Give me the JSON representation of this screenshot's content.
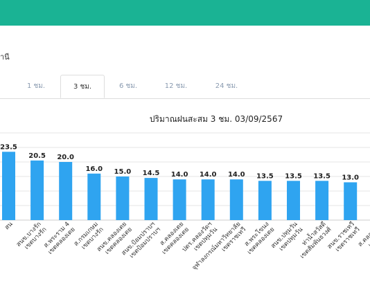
{
  "header": {
    "bar_color": "#1ab394"
  },
  "station_text": "านี",
  "tabs": [
    {
      "label": "ี",
      "active": false
    },
    {
      "label": "1 ชม.",
      "active": false
    },
    {
      "label": "3 ชม.",
      "active": true
    },
    {
      "label": "6 ชม.",
      "active": false
    },
    {
      "label": "12 ชม.",
      "active": false
    },
    {
      "label": "24 ชม.",
      "active": false
    }
  ],
  "chart_data": {
    "type": "bar",
    "title": "ปริมาณฝนสะสม 3 ชม. 03/09/2567",
    "bar_color": "#2fa4f0",
    "categories": [
      [
        "สน",
        ""
      ],
      [
        "สนข.บางรัก",
        "เขตบางรัก"
      ],
      [
        "ส.พระราม 4",
        "เขตคลองเตย"
      ],
      [
        "ส.กรมเกษม",
        "เขตบางรัก"
      ],
      [
        "สนข.คลองเตย",
        "เขตคลองเตย"
      ],
      [
        "สนข.ป้อมปราบฯ",
        "เขตป้อมปราบฯ"
      ],
      [
        "ส.คลองเตย",
        "เขตคลองเตย"
      ],
      [
        "ปตร.คลองวัดฯ",
        "เขตปทุมวัน"
      ],
      [
        "จุฬาลงกรณ์มหาวิทยาลัย",
        "เขตราชเทวี"
      ],
      [
        "ส.พระโขนง",
        "เขตคลองเตย"
      ],
      [
        "สนข.ปทุมวัน",
        "เขตปทุมวัน"
      ],
      [
        "ท่าน้ำสวัสดี",
        "เขตสัมพันธวงศ์"
      ],
      [
        "สนข.ราชเทวี",
        "เขตราชเทวี"
      ],
      [
        "ส.คลองสาม",
        "เขตคลอง"
      ]
    ],
    "values": [
      23.5,
      20.5,
      20.0,
      16.0,
      15.0,
      14.5,
      14.0,
      14.0,
      14.0,
      13.5,
      13.5,
      13.5,
      13.0,
      12.5
    ],
    "data_labels": [
      "23.5",
      "20.5",
      "20.0",
      "16.0",
      "15.0",
      "14.5",
      "14.0",
      "14.0",
      "14.0",
      "13.5",
      "13.5",
      "13.5",
      "13.0",
      ""
    ],
    "ylim": [
      0,
      30
    ],
    "grid": true
  }
}
